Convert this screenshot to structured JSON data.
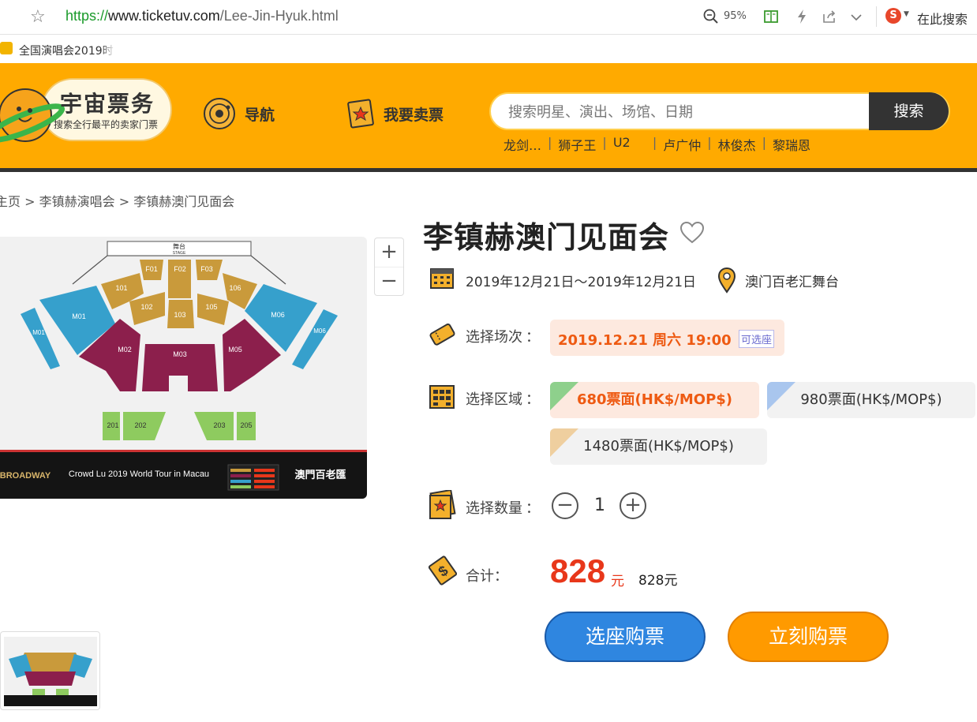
{
  "browser": {
    "url_protocol": "https://",
    "url_host": "www.ticketuv.com",
    "url_path": "/Lee-Jin-Hyuk.html",
    "zoom": "95%",
    "search_label": "在此搜索",
    "sogou_glyph": "S",
    "bookmark_label": "全国演唱会2019时"
  },
  "site": {
    "logo_title": "宇宙票务",
    "logo_slogan": "搜索全行最平的卖家门票",
    "nav": [
      {
        "label": "导航"
      },
      {
        "label": "我要卖票"
      }
    ],
    "search_placeholder": "搜索明星、演出、场馆、日期",
    "search_button": "搜索",
    "hot_links": [
      "龙剑…",
      "狮子王",
      "U2",
      "卢广仲",
      "林俊杰",
      "黎瑞恩"
    ]
  },
  "breadcrumb": {
    "home": "主页",
    "separator": ">",
    "level1": "李镇赫演唱会",
    "level2": "李镇赫澳门见面会"
  },
  "seatmap": {
    "stage_label": "舞台",
    "stage_sub": "STAGE",
    "sections_top": [
      "F01",
      "F02",
      "F03",
      "101",
      "102",
      "103",
      "105",
      "106"
    ],
    "sections_side": [
      "M01",
      "M06",
      "M01",
      "M06"
    ],
    "sections_floor": [
      "M02",
      "M03",
      "M05"
    ],
    "sections_back": [
      "201",
      "202",
      "203",
      "205"
    ],
    "banner_brand": "BROADWAY",
    "banner_tour": "Crowd Lu 2019 World Tour in Macau",
    "banner_venue": "澳門百老匯",
    "zoom_in": "+",
    "zoom_out": "−"
  },
  "event": {
    "title": "李镇赫澳门见面会",
    "date_range": "2019年12月21日～2019年12月21日",
    "venue": "澳门百老汇舞台",
    "session_label": "选择场次",
    "session_value": "2019.12.21 周六 19:00",
    "session_badge": "可选座",
    "area_label": "选择区域",
    "areas": [
      {
        "label": "680票面(HK$/MOP$)",
        "color": "#8ed08c",
        "selected": true
      },
      {
        "label": "980票面(HK$/MOP$)",
        "color": "#a9c6ee",
        "selected": false
      },
      {
        "label": "1480票面(HK$/MOP$)",
        "color": "#efcf9f",
        "selected": false
      }
    ],
    "qty_label": "选择数量",
    "qty_minus": "−",
    "qty_plus": "+",
    "quantity": "1",
    "colon": "：",
    "total_label": "合计：",
    "total_price": "828",
    "total_unit": "元",
    "total_sub": "828元",
    "btn_choose_seat": "选座购票",
    "btn_buy_now": "立刻购票"
  },
  "colors": {
    "header_bg": "#ffaa00",
    "accent_orange": "#ee5a12",
    "price_red": "#e8371a",
    "btn_blue": "#2f86e0",
    "btn_orange": "#ff9a00"
  }
}
